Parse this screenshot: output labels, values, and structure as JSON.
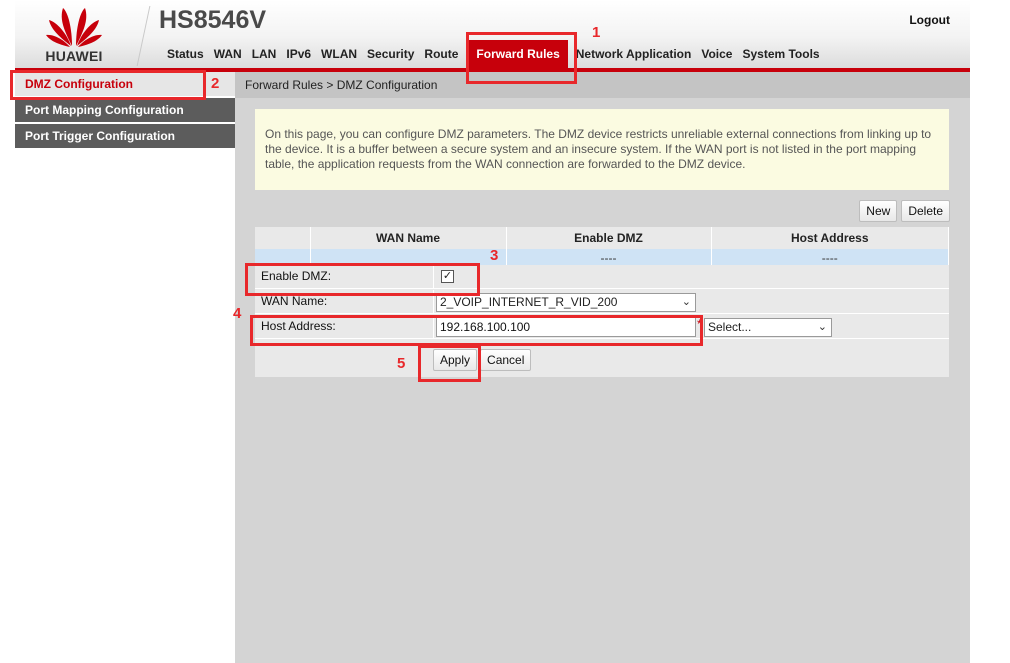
{
  "header": {
    "brand": "HUAWEI",
    "model": "HS8546V",
    "logout": "Logout",
    "nav": [
      {
        "label": "Status",
        "active": false
      },
      {
        "label": "WAN",
        "active": false
      },
      {
        "label": "LAN",
        "active": false
      },
      {
        "label": "IPv6",
        "active": false
      },
      {
        "label": "WLAN",
        "active": false
      },
      {
        "label": "Security",
        "active": false
      },
      {
        "label": "Route",
        "active": false
      },
      {
        "label": "Forward Rules",
        "active": true
      },
      {
        "label": "Network Application",
        "active": false
      },
      {
        "label": "Voice",
        "active": false
      },
      {
        "label": "System Tools",
        "active": false
      }
    ]
  },
  "sidebar": {
    "items": [
      {
        "label": "DMZ Configuration",
        "active": true
      },
      {
        "label": "Port Mapping Configuration",
        "active": false
      },
      {
        "label": "Port Trigger Configuration",
        "active": false
      }
    ]
  },
  "main": {
    "breadcrumb": "Forward Rules > DMZ Configuration",
    "info": "On this page, you can configure DMZ parameters. The DMZ device restricts unreliable external connections from linking up to the device. It is a buffer between a secure system and an insecure system. If the WAN port is not listed in the port mapping table, the application requests from the WAN connection are forwarded to the DMZ device.",
    "toolbar": {
      "new": "New",
      "delete": "Delete"
    },
    "table": {
      "headers": [
        "",
        "WAN Name",
        "Enable DMZ",
        "Host Address"
      ],
      "rows": [
        [
          "",
          "",
          "----",
          "----"
        ]
      ]
    },
    "form": {
      "enable_label": "Enable DMZ:",
      "enable_checked": true,
      "check_glyph": "✓",
      "wan_label": "WAN Name:",
      "wan_value": "2_VOIP_INTERNET_R_VID_200",
      "host_label": "Host Address:",
      "host_value": "192.168.100.100",
      "required_mark": "*",
      "select_value": "Select...",
      "apply": "Apply",
      "cancel": "Cancel"
    }
  },
  "annotations": [
    "1",
    "2",
    "3",
    "4",
    "5"
  ],
  "colors": {
    "brand_red": "#c7000b",
    "annotation_red": "#e8282b",
    "table_row": "#cfe3f5",
    "info_bg": "#fbfbe1"
  }
}
